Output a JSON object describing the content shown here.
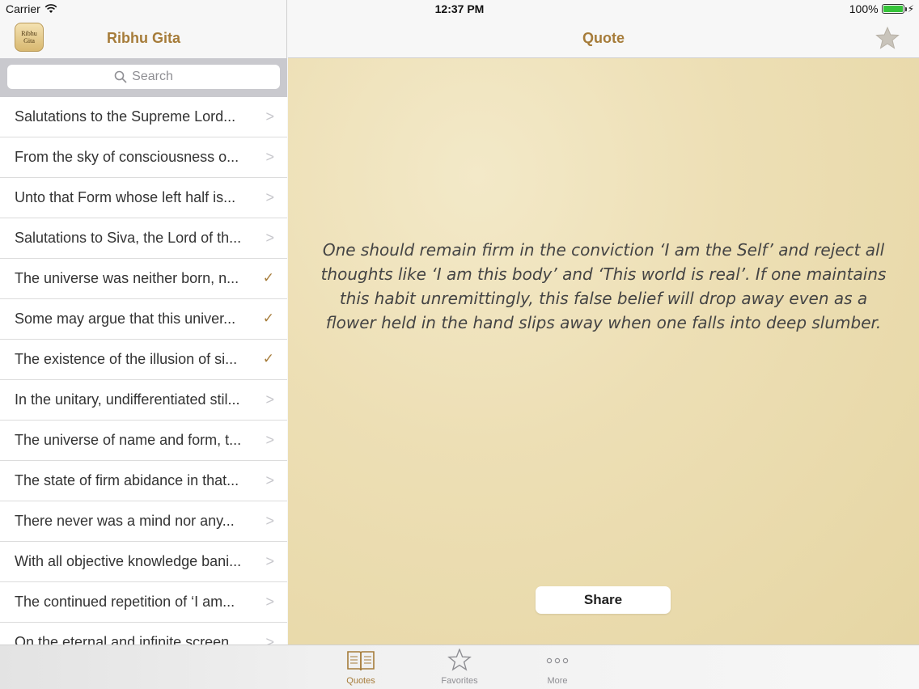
{
  "status": {
    "carrier": "Carrier",
    "time": "12:37 PM",
    "battery": "100%"
  },
  "sidebar": {
    "icon_text": "Ribhu Gita",
    "title": "Ribhu Gita",
    "search_placeholder": "Search",
    "items": [
      {
        "text": "Salutations to the Supreme Lord...",
        "accessory": ">"
      },
      {
        "text": "From the sky of consciousness o...",
        "accessory": ">"
      },
      {
        "text": "Unto that Form whose left half is...",
        "accessory": ">"
      },
      {
        "text": "Salutations to Siva, the Lord of th...",
        "accessory": ">"
      },
      {
        "text": "The universe was neither born, n...",
        "accessory": "✓"
      },
      {
        "text": "Some may argue that this univer...",
        "accessory": "✓"
      },
      {
        "text": "The existence of the illusion of si...",
        "accessory": "✓"
      },
      {
        "text": "In the unitary, undifferentiated stil...",
        "accessory": ">"
      },
      {
        "text": "The universe of name and form, t...",
        "accessory": ">"
      },
      {
        "text": "The state of firm abidance in that...",
        "accessory": ">"
      },
      {
        "text": "There never was a mind nor any...",
        "accessory": ">"
      },
      {
        "text": "With all objective knowledge bani...",
        "accessory": ">"
      },
      {
        "text": "The continued repetition of ‘I am...",
        "accessory": ">"
      },
      {
        "text": "On the eternal and infinite screen...",
        "accessory": ">"
      }
    ]
  },
  "main": {
    "title": "Quote",
    "quote": "One should remain firm in the conviction ‘I am the Self’ and reject all thoughts like ‘I am this body’ and ‘This world is real’. If one maintains this habit unremittingly, this false belief will drop away even as a flower held in the hand slips away when one falls into deep slumber.",
    "share_label": "Share"
  },
  "tabbar": {
    "tabs": [
      {
        "label": "Quotes",
        "icon": "book-icon",
        "active": true
      },
      {
        "label": "Favorites",
        "icon": "star-icon",
        "active": false
      },
      {
        "label": "More",
        "icon": "more-icon",
        "active": false
      }
    ]
  },
  "colors": {
    "accent": "#a67c3a",
    "parchment": "#ecdeb3",
    "checkmark": "#a67c3a"
  }
}
